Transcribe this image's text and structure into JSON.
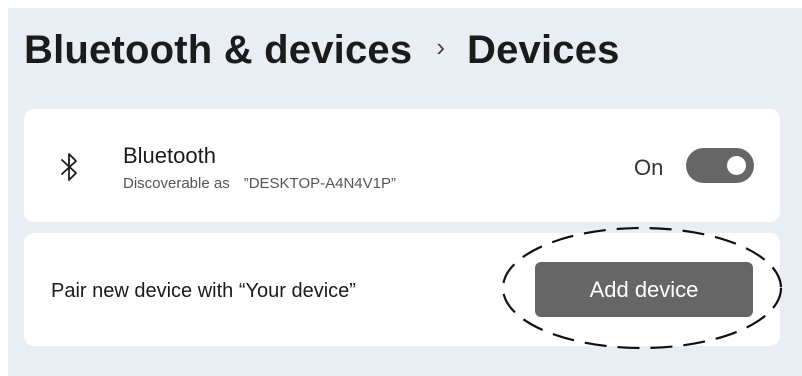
{
  "breadcrumb": {
    "parent": "Bluetooth & devices",
    "separator": "›",
    "current": "Devices"
  },
  "bluetooth": {
    "icon": "bluetooth-icon",
    "title": "Bluetooth",
    "discoverable_prefix": "Discoverable as",
    "device_name": "”DESKTOP-A4N4V1P”",
    "toggle_state_label": "On",
    "toggle_on": true
  },
  "pair": {
    "label": "Pair new device with “Your device”",
    "button_label": "Add device",
    "highlight_style": "dashed-ellipse"
  },
  "colors": {
    "background": "#e9eef5",
    "card": "#ffffff",
    "toggle": "#666666",
    "button": "#666666"
  }
}
